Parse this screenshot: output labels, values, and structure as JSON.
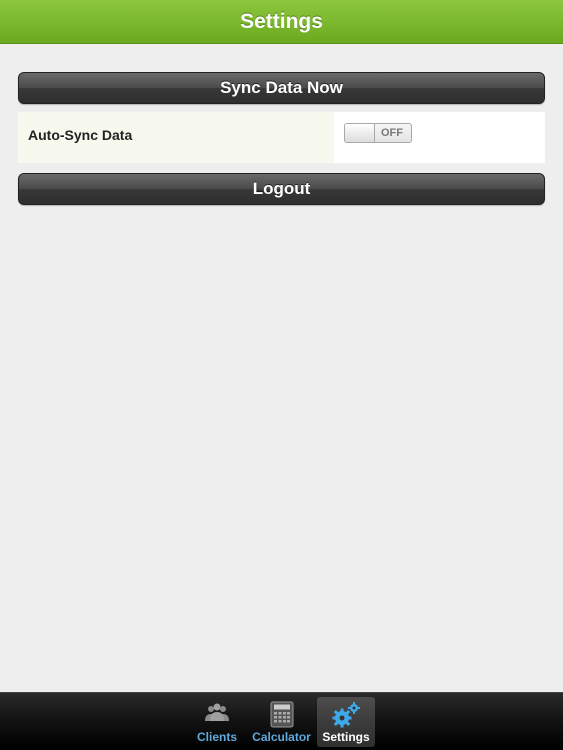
{
  "navbar": {
    "title": "Settings"
  },
  "buttons": {
    "sync_label": "Sync Data Now",
    "logout_label": "Logout"
  },
  "auto_sync": {
    "label": "Auto-Sync Data",
    "toggle_state": "OFF"
  },
  "tabbar": {
    "tabs": [
      {
        "label": "Clients",
        "icon": "people-icon",
        "selected": false
      },
      {
        "label": "Calculator",
        "icon": "calculator-icon",
        "selected": false
      },
      {
        "label": "Settings",
        "icon": "gears-icon",
        "selected": true
      }
    ]
  },
  "colors": {
    "navbar_green": "#7cb92e",
    "tab_label_blue": "#5ea9dd",
    "background": "#eeeeee"
  }
}
